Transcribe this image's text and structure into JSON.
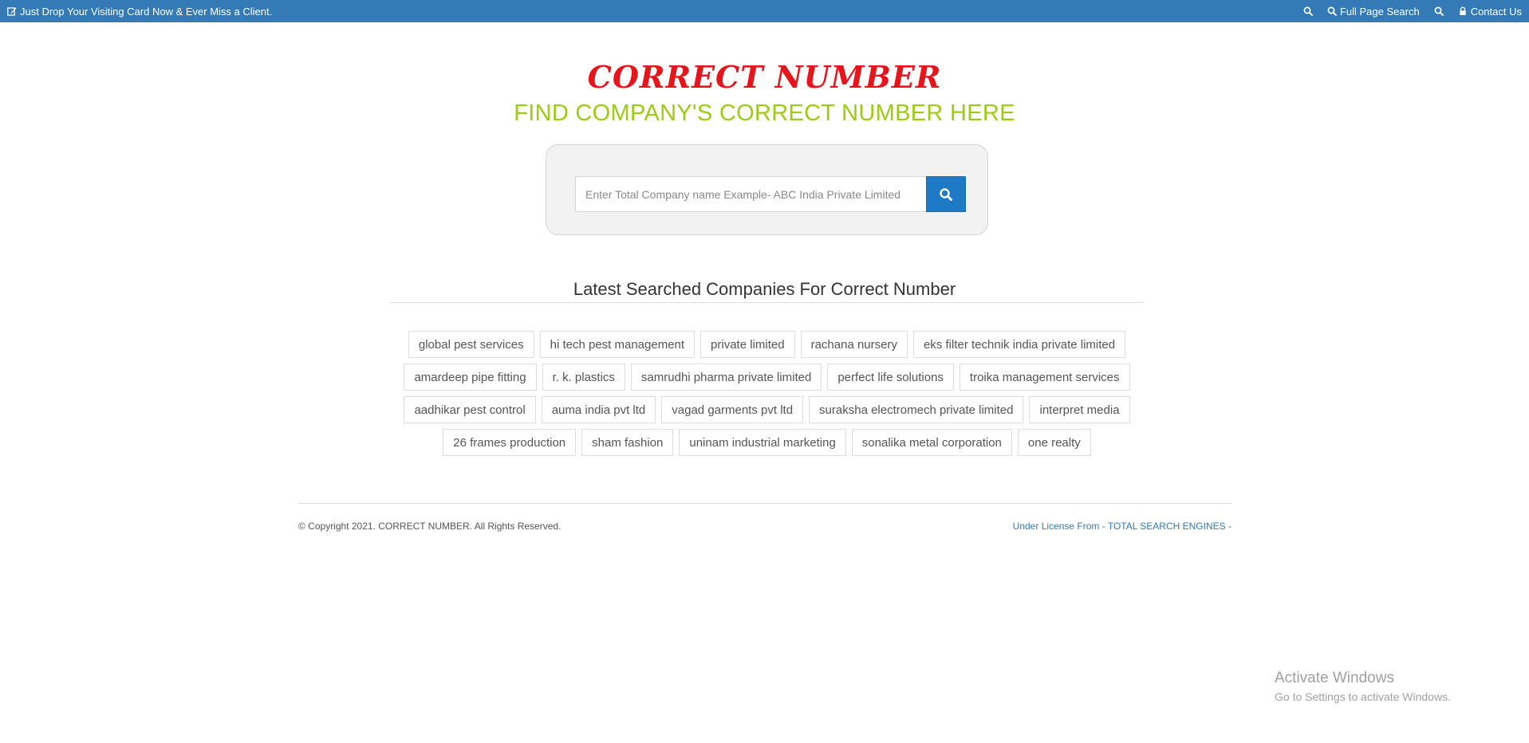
{
  "topbar": {
    "promo_text": "Just Drop Your Visiting Card Now & Ever Miss a Client.",
    "full_page_search": "Full Page Search",
    "contact_us": "Contact Us"
  },
  "header": {
    "brand": "CORRECT NUMBER",
    "tagline": "FIND COMPANY'S CORRECT NUMBER HERE"
  },
  "search": {
    "placeholder": "Enter Total Company name Example- ABC India Private Limited"
  },
  "latest": {
    "title": "Latest Searched Companies For Correct Number",
    "rows": [
      [
        "global pest services",
        "hi tech pest management",
        "private limited",
        "rachana nursery",
        "eks filter technik india private limited"
      ],
      [
        "amardeep pipe fitting",
        "r. k. plastics",
        "samrudhi pharma private limited",
        "perfect life solutions",
        "troika management services"
      ],
      [
        "aadhikar pest control",
        "auma india pvt ltd",
        "vagad garments pvt ltd",
        "suraksha electromech private limited",
        "interpret media"
      ],
      [
        "26 frames production",
        "sham fashion",
        "uninam industrial marketing",
        "sonalika metal corporation",
        "one realty"
      ]
    ]
  },
  "footer": {
    "copyright": "© Copyright 2021. CORRECT NUMBER. All Rights Reserved.",
    "license_prefix": "Under License From -",
    "license_link": "TOTAL SEARCH ENGINES",
    "license_suffix": "-"
  },
  "watermark": {
    "line1": "Activate Windows",
    "line2": "Go to Settings to activate Windows."
  },
  "colors": {
    "topbar": "#337ab7",
    "brand": "#e8141c",
    "tagline": "#9ccc10",
    "search_button": "#1f7ac6"
  }
}
